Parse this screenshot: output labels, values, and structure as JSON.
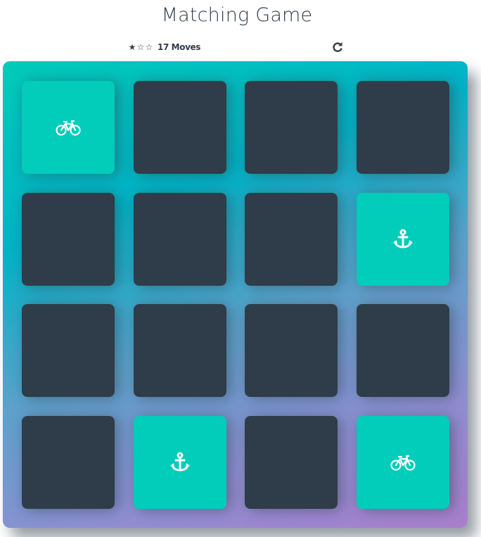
{
  "header": {
    "title": "Matching Game"
  },
  "score_panel": {
    "stars": [
      "★",
      "☆",
      "☆"
    ],
    "stars_filled": 1,
    "moves_label": "17 Moves",
    "restart_icon": "redo-icon"
  },
  "colors": {
    "card_back": "#2e3d49",
    "card_matched": "#02ccba",
    "text": "#2e3d49"
  },
  "deck": {
    "rows": 4,
    "cols": 4,
    "cards": [
      {
        "state": "match",
        "icon": "bicycle"
      },
      {
        "state": "hidden",
        "icon": ""
      },
      {
        "state": "hidden",
        "icon": ""
      },
      {
        "state": "hidden",
        "icon": ""
      },
      {
        "state": "hidden",
        "icon": ""
      },
      {
        "state": "hidden",
        "icon": ""
      },
      {
        "state": "hidden",
        "icon": ""
      },
      {
        "state": "match",
        "icon": "anchor"
      },
      {
        "state": "hidden",
        "icon": ""
      },
      {
        "state": "hidden",
        "icon": ""
      },
      {
        "state": "hidden",
        "icon": ""
      },
      {
        "state": "hidden",
        "icon": ""
      },
      {
        "state": "hidden",
        "icon": ""
      },
      {
        "state": "match",
        "icon": "anchor"
      },
      {
        "state": "hidden",
        "icon": ""
      },
      {
        "state": "match",
        "icon": "bicycle"
      }
    ]
  }
}
